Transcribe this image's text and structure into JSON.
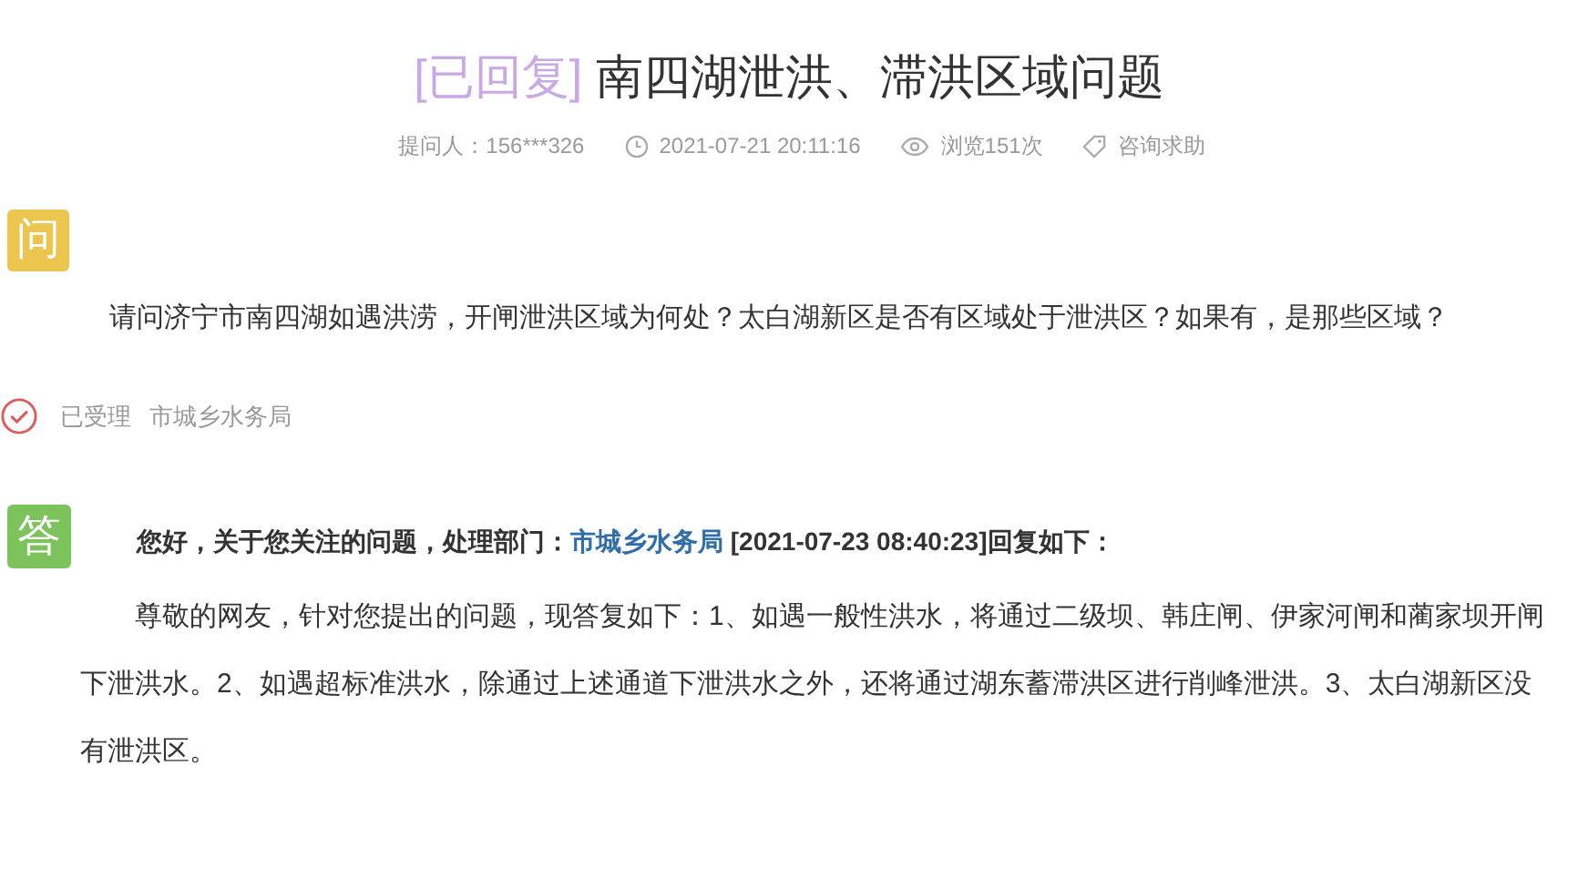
{
  "title": {
    "status": "[已回复]",
    "text": "南四湖泄洪、滞洪区域问题"
  },
  "meta": {
    "asker": "提问人：156***326",
    "time": "2021-07-21 20:11:16",
    "views": "浏览151次",
    "category": "咨询求助"
  },
  "question": {
    "badge": "问",
    "text": "请问济宁市南四湖如遇洪涝，开闸泄洪区域为何处？太白湖新区是否有区域处于泄洪区？如果有，是那些区域？"
  },
  "status": {
    "label": "已受理",
    "department": "市城乡水务局"
  },
  "answer": {
    "badge": "答",
    "intro": "您好，关于您关注的问题，处理部门：",
    "department": "市城乡水务局",
    "outro": " [2021-07-23 08:40:23]回复如下：",
    "text": "尊敬的网友，针对您提出的问题，现答复如下：1、如遇一般性洪水，将通过二级坝、韩庄闸、伊家河闸和蔺家坝开闸下泄洪水。2、如遇超标准洪水，除通过上述通道下泄洪水之外，还将通过湖东蓄滞洪区进行削峰泄洪。3、太白湖新区没有泄洪区。"
  }
}
